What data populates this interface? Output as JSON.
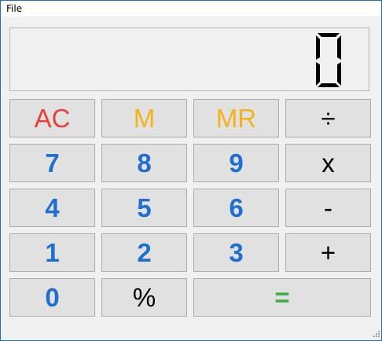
{
  "menu": {
    "file_label": "File"
  },
  "display": {
    "value": "0"
  },
  "buttons": [
    {
      "id": "ac",
      "label": "AC",
      "name": "ac-button",
      "color": "#e8413a",
      "bold": false
    },
    {
      "id": "m",
      "label": "M",
      "name": "memory-button",
      "color": "#f5b21a",
      "bold": false
    },
    {
      "id": "mr",
      "label": "MR",
      "name": "memory-recall-button",
      "color": "#f5b21a",
      "bold": false
    },
    {
      "id": "div",
      "label": "÷",
      "name": "divide-button",
      "color": "#000000",
      "bold": false
    },
    {
      "id": "7",
      "label": "7",
      "name": "digit-7-button",
      "color": "#1f6fd0",
      "bold": true
    },
    {
      "id": "8",
      "label": "8",
      "name": "digit-8-button",
      "color": "#1f6fd0",
      "bold": true
    },
    {
      "id": "9",
      "label": "9",
      "name": "digit-9-button",
      "color": "#1f6fd0",
      "bold": true
    },
    {
      "id": "mul",
      "label": "x",
      "name": "multiply-button",
      "color": "#000000",
      "bold": false
    },
    {
      "id": "4",
      "label": "4",
      "name": "digit-4-button",
      "color": "#1f6fd0",
      "bold": true
    },
    {
      "id": "5",
      "label": "5",
      "name": "digit-5-button",
      "color": "#1f6fd0",
      "bold": true
    },
    {
      "id": "6",
      "label": "6",
      "name": "digit-6-button",
      "color": "#1f6fd0",
      "bold": true
    },
    {
      "id": "sub",
      "label": "-",
      "name": "subtract-button",
      "color": "#000000",
      "bold": false
    },
    {
      "id": "1",
      "label": "1",
      "name": "digit-1-button",
      "color": "#1f6fd0",
      "bold": true
    },
    {
      "id": "2",
      "label": "2",
      "name": "digit-2-button",
      "color": "#1f6fd0",
      "bold": true
    },
    {
      "id": "3",
      "label": "3",
      "name": "digit-3-button",
      "color": "#1f6fd0",
      "bold": true
    },
    {
      "id": "add",
      "label": "+",
      "name": "add-button",
      "color": "#000000",
      "bold": false
    },
    {
      "id": "0",
      "label": "0",
      "name": "digit-0-button",
      "color": "#1f6fd0",
      "bold": true
    },
    {
      "id": "pct",
      "label": "%",
      "name": "percent-button",
      "color": "#000000",
      "bold": false
    },
    {
      "id": "eq",
      "label": "=",
      "name": "equals-button",
      "color": "#3fae49",
      "bold": true
    }
  ]
}
